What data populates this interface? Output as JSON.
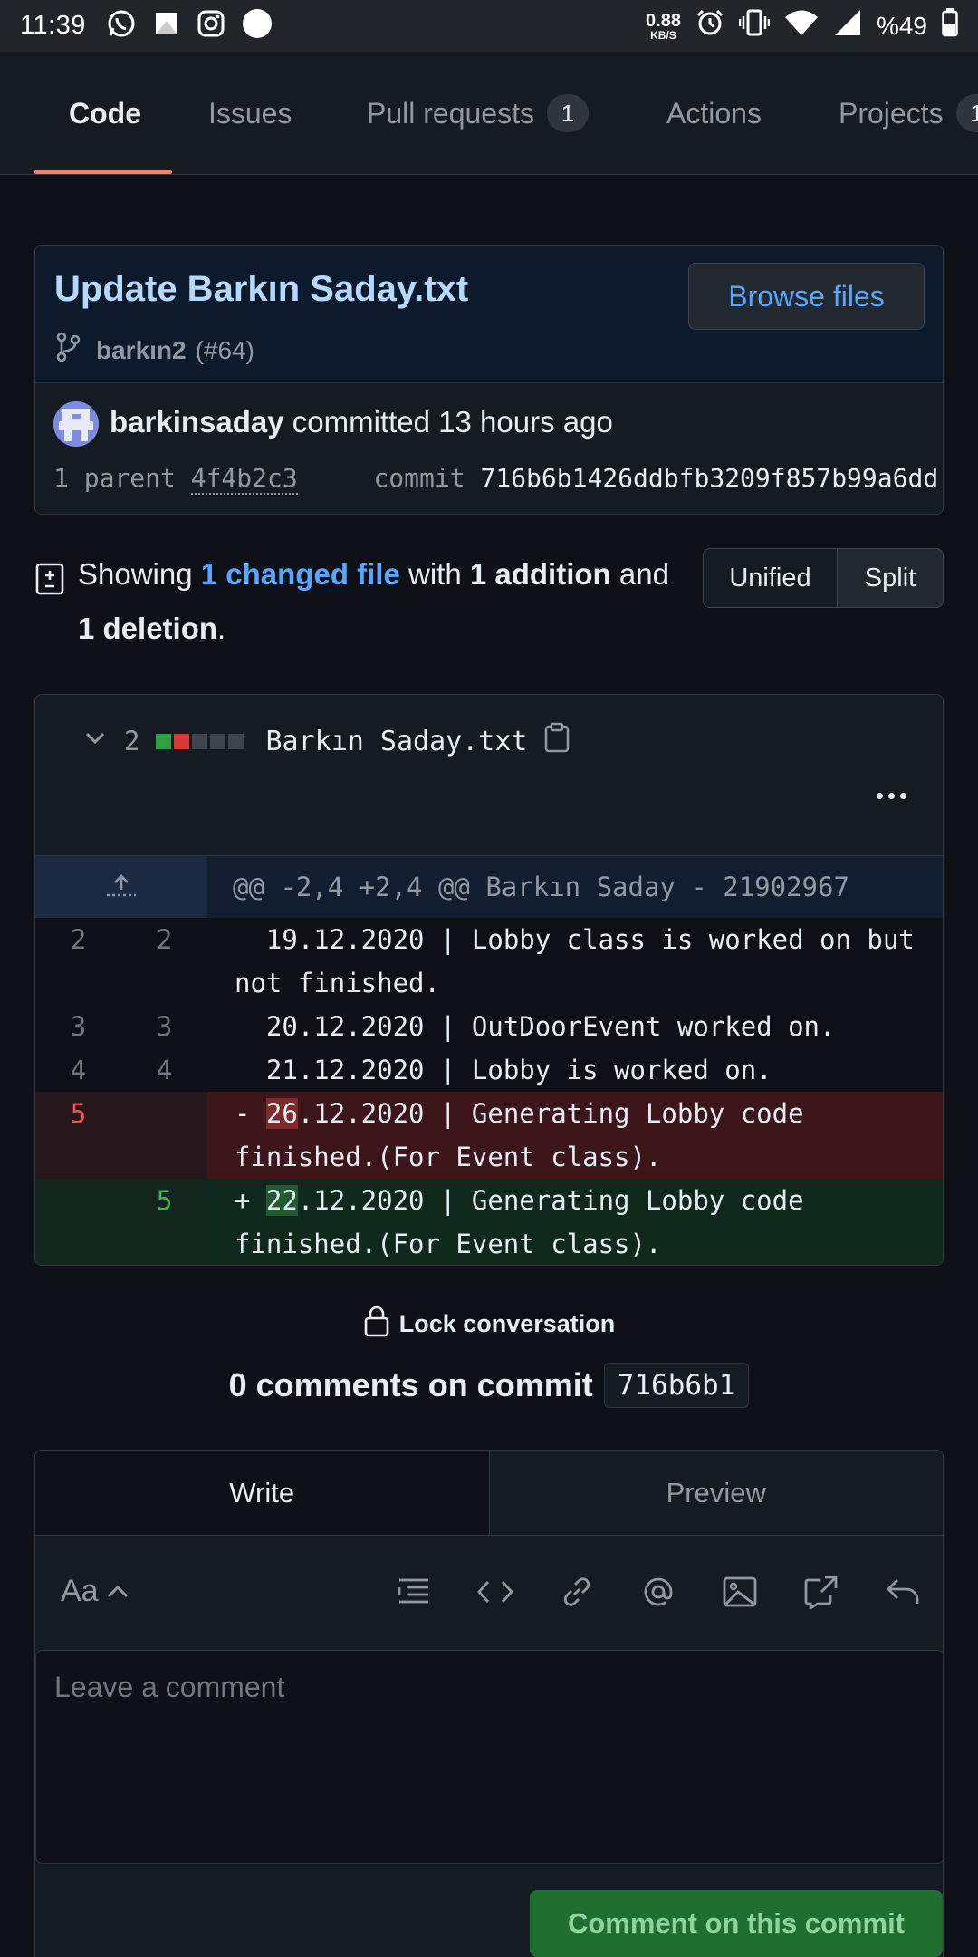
{
  "status_bar": {
    "time": "11:39",
    "net_speed_value": "0.88",
    "net_speed_unit": "KB/S",
    "battery": "%49",
    "left_icons": [
      "whatsapp-icon",
      "gallery-icon",
      "instagram-icon",
      "circle-icon"
    ],
    "right_icons": [
      "alarm-icon",
      "vibrate-icon",
      "wifi-icon",
      "signal-icon",
      "battery-icon"
    ]
  },
  "tabs": [
    {
      "label": "Code",
      "active": true
    },
    {
      "label": "Issues"
    },
    {
      "label": "Pull requests",
      "count": "1"
    },
    {
      "label": "Actions"
    },
    {
      "label": "Projects",
      "count": "1"
    }
  ],
  "commit": {
    "title": "Update Barkın Saday.txt",
    "branch": "barkın2",
    "pr_ref": "(#64)",
    "browse_label": "Browse files",
    "author": "barkinsaday",
    "action_text": "committed 13 hours ago",
    "parent_label": "1 parent",
    "parent_sha": "4f4b2c3",
    "commit_label": "commit",
    "full_sha": "716b6b1426ddbfb3209f857b99a6dd"
  },
  "summary": {
    "prefix": "Showing",
    "changed_files": "1 changed file",
    "with": "with",
    "additions": "1 addition",
    "and": "and",
    "deletions": "1 deletion",
    "suffix": ".",
    "unified_label": "Unified",
    "split_label": "Split"
  },
  "file": {
    "changes": "2",
    "name": "Barkın Saday.txt",
    "diffstat_colors": [
      "#2ea043",
      "#da3633",
      "#3d444d",
      "#3d444d",
      "#3d444d"
    ],
    "hunk_header": "@@ -2,4 +2,4 @@ Barkın Saday - 21902967",
    "lines": [
      {
        "type": "ctx",
        "old": "2",
        "new": "2",
        "text": "  19.12.2020 | Lobby class is worked on but not finished."
      },
      {
        "type": "ctx",
        "old": "3",
        "new": "3",
        "text": "  20.12.2020 | OutDoorEvent worked on."
      },
      {
        "type": "ctx",
        "old": "4",
        "new": "4",
        "text": "  21.12.2020 | Lobby is worked on."
      },
      {
        "type": "del",
        "old": "5",
        "new": "",
        "marker": "- ",
        "highlight": "26",
        "rest": ".12.2020 | Generating Lobby code finished.(For Event class)."
      },
      {
        "type": "add",
        "old": "",
        "new": "5",
        "marker": "+ ",
        "highlight": "22",
        "rest": ".12.2020 | Generating Lobby code finished.(For Event class)."
      }
    ]
  },
  "conversation": {
    "lock_label": "Lock conversation",
    "comments_title": "0 comments on commit",
    "short_sha": "716b6b1"
  },
  "comment_form": {
    "write_tab": "Write",
    "preview_tab": "Preview",
    "text_style_label": "Aa",
    "placeholder": "Leave a comment",
    "submit_label": "Comment on this commit"
  }
}
